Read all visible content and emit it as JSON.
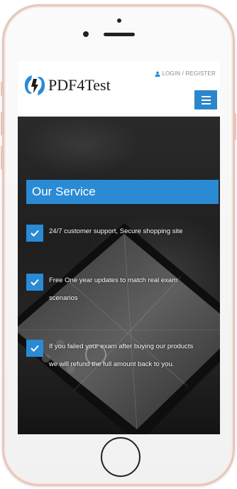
{
  "header": {
    "logo_text": "PDF4Test",
    "login_label": "LOGIN / REGISTER"
  },
  "service": {
    "title": "Our Service",
    "features": [
      {
        "text": "24/7 customer support, Secure shopping site"
      },
      {
        "line1": "Free One year updates to match real exam",
        "line2": "scenarios"
      },
      {
        "line1": "If you failed your exam after buying our products",
        "line2": "we will refund the full amount back to you."
      }
    ]
  },
  "colors": {
    "accent": "#2a8ad4",
    "menu_button": "#2b86cc",
    "phone_frame": "#e6c6bd"
  },
  "icons": {
    "logo": "pdf4test-logo-icon",
    "user": "user-icon",
    "menu": "hamburger-menu-icon",
    "check": "check-icon"
  }
}
